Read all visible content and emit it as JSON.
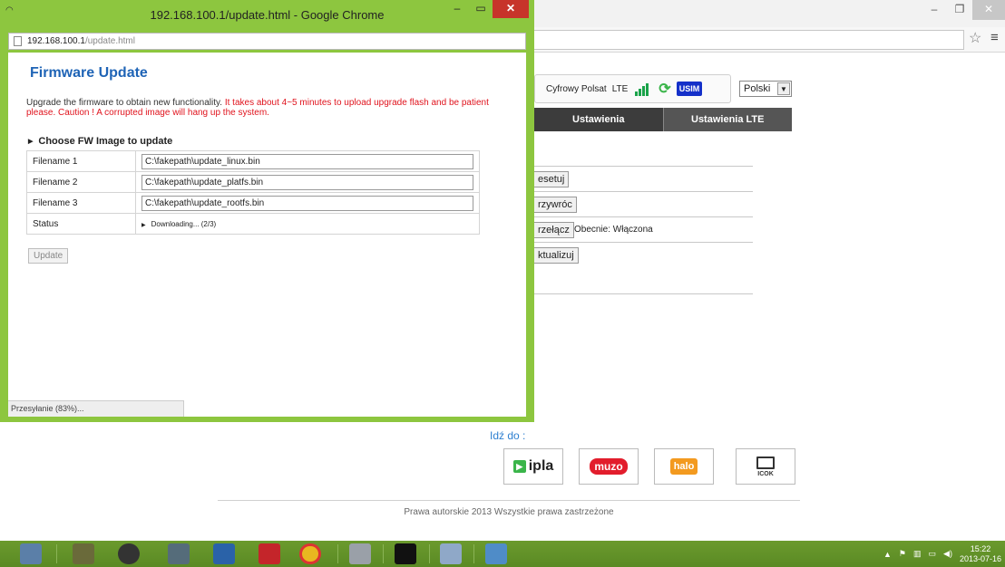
{
  "popup": {
    "window_title": "192.168.100.1/update.html - Google Chrome",
    "url_host": "192.168.100.1",
    "url_path": "/update.html",
    "status_bar": "Przesyłanie (83%)...",
    "page": {
      "title": "Firmware Update",
      "desc_normal": "Upgrade the firmware to obtain new functionality. ",
      "desc_warning": "It takes about 4~5 minutes to upload upgrade flash and be patient please. Caution !   A corrupted image will hang up the system.",
      "choose_heading": "Choose FW Image to update",
      "rows": [
        {
          "label": "Filename 1",
          "value": "C:\\fakepath\\update_linux.bin"
        },
        {
          "label": "Filename 2",
          "value": "C:\\fakepath\\update_platfs.bin"
        },
        {
          "label": "Filename 3",
          "value": "C:\\fakepath\\update_rootfs.bin"
        }
      ],
      "status_label": "Status",
      "status_value": "Downloading... (2/3)",
      "update_button": "Update"
    }
  },
  "router": {
    "operator": "Cyfrowy Polsat",
    "network": "LTE",
    "usim": "USIM",
    "language": "Polski",
    "nav": {
      "settings": "Ustawienia",
      "lte_settings": "Ustawienia LTE"
    },
    "buttons": {
      "reset": "esetuj",
      "restore": "rzywróc",
      "toggle": "rzełącz",
      "update": "ktualizuj"
    },
    "toggle_status": "Obecnie: Włączona",
    "goto_label": "Idź do :",
    "tiles": {
      "ipla": "ipla",
      "muzo": "muzo",
      "halo": "halo",
      "icok": "ICOK"
    },
    "footer": "Prawa autorskie 2013 Wszystkie prawa zastrzeżone"
  },
  "taskbar": {
    "time": "15:22",
    "date": "2013-07-16"
  }
}
